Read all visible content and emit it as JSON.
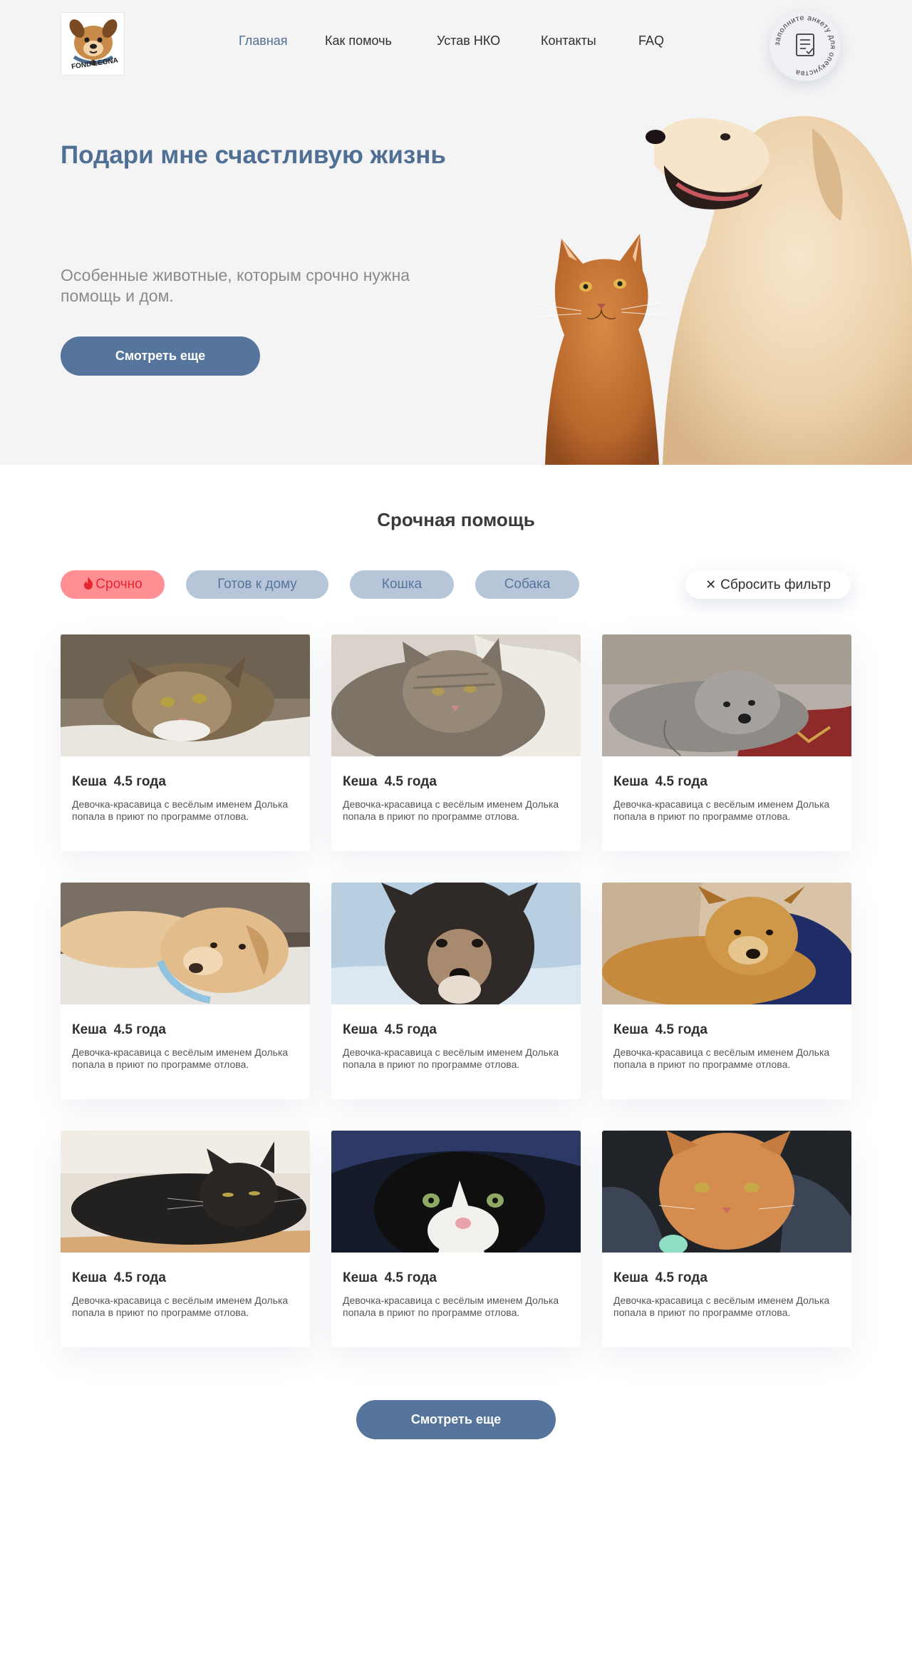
{
  "header": {
    "logo_text": "FOND LEONA",
    "nav": [
      {
        "label": "Главная",
        "active": true
      },
      {
        "label": "Как помочь",
        "active": false
      },
      {
        "label": "Устав НКО",
        "active": false
      },
      {
        "label": "Контакты",
        "active": false
      },
      {
        "label": "FAQ",
        "active": false
      }
    ],
    "badge_text": "заполните анкету для опекунства"
  },
  "hero": {
    "title": "Подари мне счастливую жизнь",
    "subtitle": "Особенные животные, которым срочно нужна помощь и дом.",
    "button": "Смотреть еще"
  },
  "section": {
    "title": "Срочная помощь",
    "filters": {
      "urgent": "Срочно",
      "ready_home": "Готов к дому",
      "cat": "Кошка",
      "dog": "Собака"
    },
    "reset": "Сбросить фильтр",
    "more_button": "Смотреть еще"
  },
  "cards": [
    {
      "name": "Кеша",
      "age": "4.5 года",
      "desc": "Девочка-красавица с весёлым именем Долька попала в приют по программе отлова.",
      "photo": "tabby-cat"
    },
    {
      "name": "Кеша",
      "age": "4.5 года",
      "desc": "Девочка-красавица с весёлым именем Долька попала в приют по программе отлова.",
      "photo": "grey-tabby-cat"
    },
    {
      "name": "Кеша",
      "age": "4.5 года",
      "desc": "Девочка-красавица с весёлым именем Долька попала в приют по программе отлова.",
      "photo": "grey-terrier-dog"
    },
    {
      "name": "Кеша",
      "age": "4.5 года",
      "desc": "Девочка-красавица с весёлым именем Долька попала в приют по программе отлова.",
      "photo": "golden-dog-bandaged"
    },
    {
      "name": "Кеша",
      "age": "4.5 года",
      "desc": "Девочка-красавица с весёлым именем Долька попала в приют по программе отлова.",
      "photo": "black-dog-snow"
    },
    {
      "name": "Кеша",
      "age": "4.5 года",
      "desc": "Девочка-красавица с весёлым именем Долька попала в приют по программе отлова.",
      "photo": "ginger-dog-blanket"
    },
    {
      "name": "Кеша",
      "age": "4.5 года",
      "desc": "Девочка-красавица с весёлым именем Долька попала в приют по программе отлова.",
      "photo": "black-cat"
    },
    {
      "name": "Кеша",
      "age": "4.5 года",
      "desc": "Девочка-красавица с весёлым именем Долька попала в приют по программе отлова.",
      "photo": "black-white-cat"
    },
    {
      "name": "Кеша",
      "age": "4.5 года",
      "desc": "Девочка-красавица с весёлым именем Долька попала в приют по программе отлова.",
      "photo": "ginger-cat"
    }
  ]
}
